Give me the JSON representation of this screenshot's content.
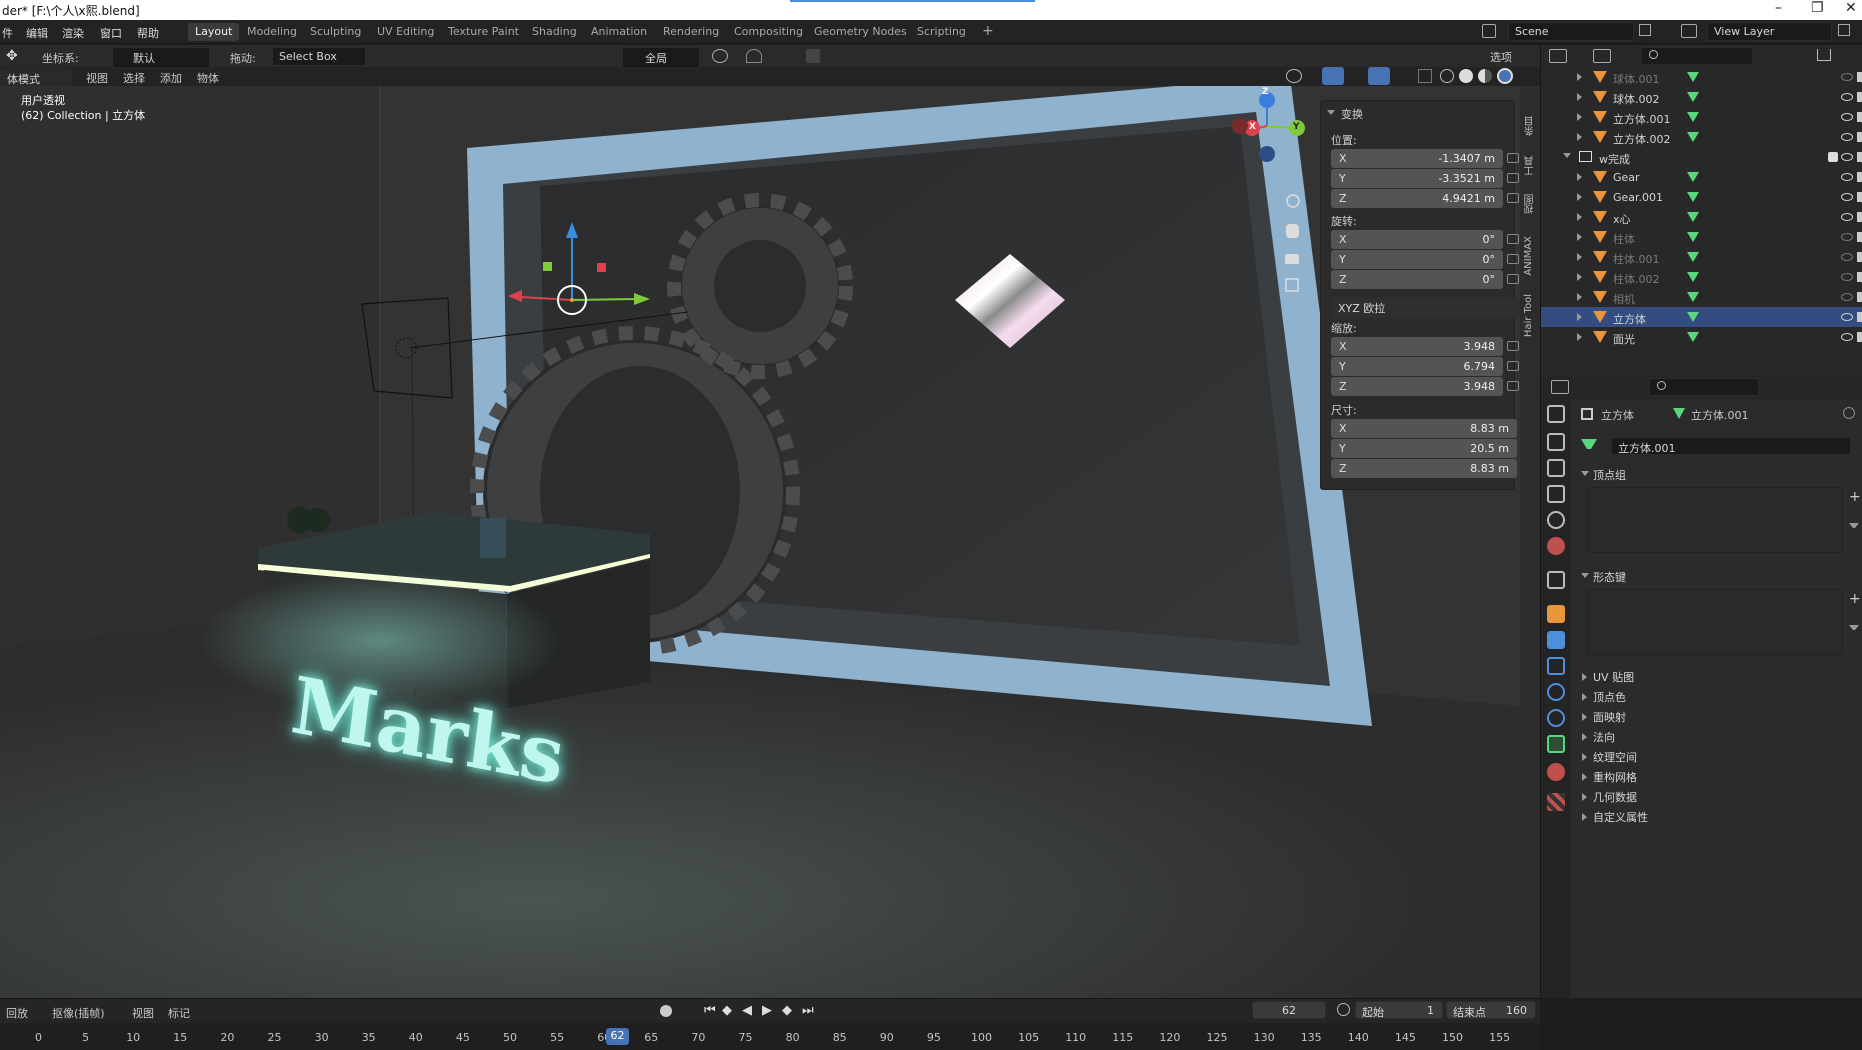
{
  "window": {
    "title": "der* [F:\\个人\\x熙.blend]",
    "controls": [
      "–",
      "❐",
      "✕"
    ]
  },
  "menubar": {
    "items": [
      "件",
      "编辑",
      "渲染",
      "窗口",
      "帮助"
    ]
  },
  "workspaces": {
    "tabs": [
      "Layout",
      "Modeling",
      "Sculpting",
      "UV Editing",
      "Texture Paint",
      "Shading",
      "Animation",
      "Rendering",
      "Compositing",
      "Geometry Nodes",
      "Scripting"
    ],
    "active": "Layout",
    "add_label": "+"
  },
  "scene": {
    "name": "Scene",
    "view_layer": "View Layer"
  },
  "tool_header": {
    "coord_label": "坐标系:",
    "coord_value": "默认",
    "drag_label": "拖动:",
    "drag_value": "Select Box",
    "pivot_value": "全局",
    "options_label": "选项"
  },
  "viewport_header": {
    "mode": "体模式",
    "items": [
      "视图",
      "选择",
      "添加",
      "物体"
    ]
  },
  "viewport": {
    "view_name": "用户透视",
    "collection_info": "(62) Collection | 立方体",
    "sign_text": "Marks",
    "gizmo_axes": [
      "Z",
      "X",
      "Y"
    ]
  },
  "npanel": {
    "section": "变换",
    "location_label": "位置:",
    "location": [
      [
        "X",
        "-1.3407 m"
      ],
      [
        "Y",
        "-3.3521 m"
      ],
      [
        "Z",
        "4.9421 m"
      ]
    ],
    "rotation_label": "旋转:",
    "rotation": [
      [
        "X",
        "0°"
      ],
      [
        "Y",
        "0°"
      ],
      [
        "Z",
        "0°"
      ]
    ],
    "rotation_mode": "XYZ 欧拉",
    "scale_label": "缩放:",
    "scale": [
      [
        "X",
        "3.948"
      ],
      [
        "Y",
        "6.794"
      ],
      [
        "Z",
        "3.948"
      ]
    ],
    "dimensions_label": "尺寸:",
    "dimensions": [
      [
        "X",
        "8.83 m"
      ],
      [
        "Y",
        "20.5 m"
      ],
      [
        "Z",
        "8.83 m"
      ]
    ]
  },
  "sidebar_tabs": [
    "条目",
    "工具",
    "视图",
    "ANIMAX",
    "Hair Tool"
  ],
  "outliner": {
    "rows": [
      {
        "name": "球体.001",
        "depth": 1,
        "dim": true,
        "selected": false
      },
      {
        "name": "球体.002",
        "depth": 1,
        "dim": false,
        "selected": false
      },
      {
        "name": "立方体.001",
        "depth": 1,
        "dim": false,
        "selected": false
      },
      {
        "name": "立方体.002",
        "depth": 1,
        "dim": false,
        "selected": false
      },
      {
        "name": "w完成",
        "depth": 0,
        "dim": false,
        "selected": false,
        "collection": true
      },
      {
        "name": "Gear",
        "depth": 1,
        "dim": false,
        "selected": false
      },
      {
        "name": "Gear.001",
        "depth": 1,
        "dim": false,
        "selected": false
      },
      {
        "name": "x心",
        "depth": 1,
        "dim": false,
        "selected": false
      },
      {
        "name": "柱体",
        "depth": 1,
        "dim": true,
        "selected": false
      },
      {
        "name": "柱体.001",
        "depth": 1,
        "dim": true,
        "selected": false
      },
      {
        "name": "柱体.002",
        "depth": 1,
        "dim": true,
        "selected": false
      },
      {
        "name": "相机",
        "depth": 1,
        "dim": true,
        "selected": false
      },
      {
        "name": "立方体",
        "depth": 1,
        "dim": false,
        "selected": true
      },
      {
        "name": "面光",
        "depth": 1,
        "dim": false,
        "selected": false
      }
    ]
  },
  "properties": {
    "object_name": "立方体",
    "mesh_name": "立方体.001",
    "mesh_field": "立方体.001",
    "panels_open": [
      "顶点组",
      "形态键"
    ],
    "panels_closed": [
      "UV 贴图",
      "顶点色",
      "面映射",
      "法向",
      "纹理空间",
      "重构网格",
      "几何数据",
      "自定义属性"
    ]
  },
  "timeline": {
    "playback_label": "回放",
    "keying_label": "抠像(插帧)",
    "view_label": "视图",
    "marker_label": "标记",
    "current_frame": "62",
    "start_label": "起始",
    "start_value": "1",
    "end_label": "结束点",
    "end_value": "160",
    "ticks": [
      "0",
      "5",
      "10",
      "15",
      "20",
      "25",
      "30",
      "35",
      "40",
      "45",
      "50",
      "55",
      "60",
      "65",
      "70",
      "75",
      "80",
      "85",
      "90",
      "95",
      "100",
      "105",
      "110",
      "115",
      "120",
      "125",
      "130",
      "135",
      "140",
      "145",
      "150",
      "155"
    ]
  },
  "colors": {
    "accent": "#4772b3",
    "selected_row": "#334d80",
    "mesh_icon": "#e8953c",
    "data_icon": "#5ad67d",
    "frame_blue": "#8fb2cf",
    "neon": "#bff7ef"
  }
}
